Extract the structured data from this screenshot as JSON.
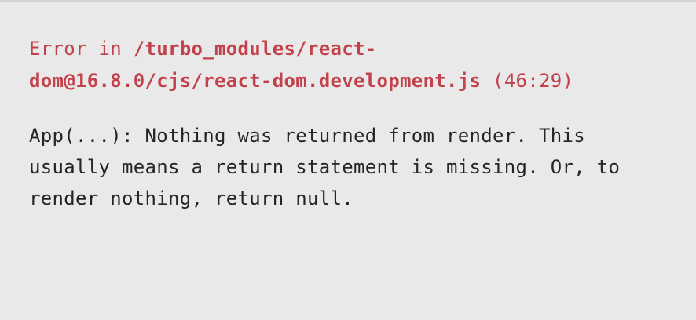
{
  "error": {
    "prefix": "Error in ",
    "path_line1": "/turbo_modules/react-",
    "path_line2": "dom@16.8.0/cjs/react-dom.development.js",
    "location": "(46:29)",
    "message_lines": [
      "App(...): Nothing was returned from render. This",
      "usually means a return statement is missing. Or, to",
      "render nothing, return null."
    ]
  },
  "colors": {
    "background": "#e9e9e9",
    "error_red": "#c3414b",
    "text": "#252525"
  }
}
